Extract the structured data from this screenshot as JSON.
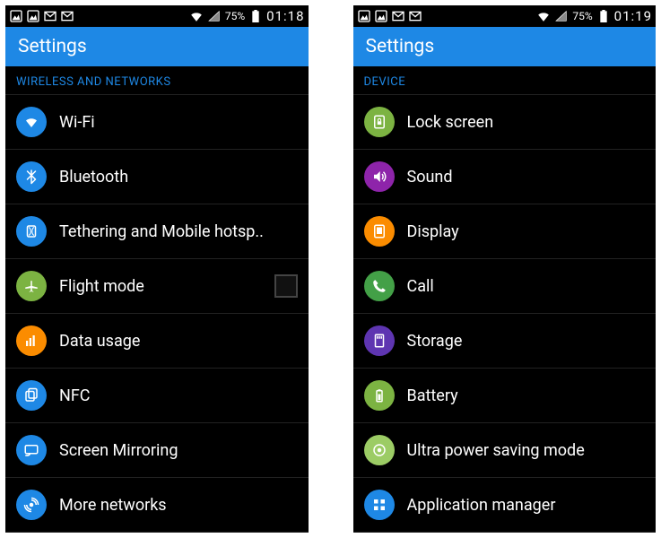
{
  "phones": [
    {
      "status": {
        "battery": "75%",
        "time": "01:18"
      },
      "appbar_title": "Settings",
      "section": "WIRELESS AND NETWORKS",
      "items": [
        {
          "label": "Wi-Fi",
          "icon": "wifi-icon",
          "color": "c-blue",
          "has_toggle": false
        },
        {
          "label": "Bluetooth",
          "icon": "bluetooth-icon",
          "color": "c-blue",
          "has_toggle": false
        },
        {
          "label": "Tethering and Mobile hotsp..",
          "icon": "hotspot-icon",
          "color": "c-blue",
          "has_toggle": false
        },
        {
          "label": "Flight mode",
          "icon": "airplane-icon",
          "color": "c-green",
          "has_toggle": true
        },
        {
          "label": "Data usage",
          "icon": "data-usage-icon",
          "color": "c-orange",
          "has_toggle": false
        },
        {
          "label": "NFC",
          "icon": "nfc-icon",
          "color": "c-blue",
          "has_toggle": false
        },
        {
          "label": "Screen Mirroring",
          "icon": "screen-mirroring-icon",
          "color": "c-blue",
          "has_toggle": false
        },
        {
          "label": "More networks",
          "icon": "more-networks-icon",
          "color": "c-blue",
          "has_toggle": false
        }
      ]
    },
    {
      "status": {
        "battery": "75%",
        "time": "01:19"
      },
      "appbar_title": "Settings",
      "section": "DEVICE",
      "items": [
        {
          "label": "Lock screen",
          "icon": "lock-screen-icon",
          "color": "c-green",
          "has_toggle": false
        },
        {
          "label": "Sound",
          "icon": "sound-icon",
          "color": "c-purple",
          "has_toggle": false
        },
        {
          "label": "Display",
          "icon": "display-icon",
          "color": "c-orange",
          "has_toggle": false
        },
        {
          "label": "Call",
          "icon": "call-icon",
          "color": "c-green2",
          "has_toggle": false
        },
        {
          "label": "Storage",
          "icon": "storage-icon",
          "color": "c-violet",
          "has_toggle": false
        },
        {
          "label": "Battery",
          "icon": "battery-icon",
          "color": "c-green",
          "has_toggle": false
        },
        {
          "label": "Ultra power saving mode",
          "icon": "power-saving-icon",
          "color": "c-lime",
          "has_toggle": false
        },
        {
          "label": "Application manager",
          "icon": "apps-icon",
          "color": "c-blue",
          "has_toggle": false
        }
      ]
    }
  ]
}
